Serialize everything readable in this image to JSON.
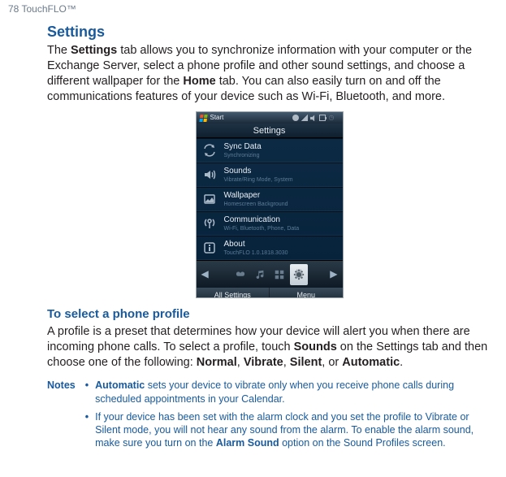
{
  "page_header": "78  TouchFLO™",
  "heading": "Settings",
  "intro_parts": {
    "p1": "The ",
    "b1": "Settings",
    "p2": " tab allows you to synchronize information with your computer or the Exchange Server, select a phone profile and other sound settings, and choose a different wallpaper for the ",
    "b2": "Home",
    "p3": " tab. You can also easily turn on and off the communications features of your device such as Wi-Fi, Bluetooth, and more."
  },
  "phone": {
    "topbar_label": "Start",
    "title": "Settings",
    "items": [
      {
        "label": "Sync Data",
        "sub": "Synchronizing",
        "icon": "sync-icon"
      },
      {
        "label": "Sounds",
        "sub": "Vibrate/Ring Mode, System",
        "icon": "speaker-icon"
      },
      {
        "label": "Wallpaper",
        "sub": "Homescreen Background",
        "icon": "wallpaper-icon"
      },
      {
        "label": "Communication",
        "sub": "Wi-Fi, Bluetooth, Phone, Data",
        "icon": "antenna-icon"
      },
      {
        "label": "About",
        "sub": "TouchFLO 1.0.1818.3030",
        "icon": "info-icon"
      }
    ],
    "softkeys": {
      "left": "All Settings",
      "right": "Menu"
    }
  },
  "subheading": "To select a phone profile",
  "profile_parts": {
    "p1": "A profile is a preset that determines how your device will alert you when there are incoming phone calls. To select a profile, touch ",
    "b1": "Sounds",
    "p2": " on the Settings tab and then choose one of the following: ",
    "b2": "Normal",
    "sep1": ", ",
    "b3": "Vibrate",
    "sep2": ", ",
    "b4": "Silent",
    "sep3": ", or ",
    "b5": "Automatic",
    "end": "."
  },
  "notes_label": "Notes",
  "bullet": "•",
  "note1_parts": {
    "b1": "Automatic",
    "p1": " sets your device to vibrate only when you receive phone calls during scheduled appointments in your Calendar."
  },
  "note2_parts": {
    "p1": "If your device has been set with the alarm clock and you set the profile to Vibrate or Silent mode, you will not hear any sound from the alarm. To enable the alarm sound, make sure you turn on the ",
    "b1": "Alarm Sound",
    "p2": " option on the Sound Profiles screen."
  }
}
